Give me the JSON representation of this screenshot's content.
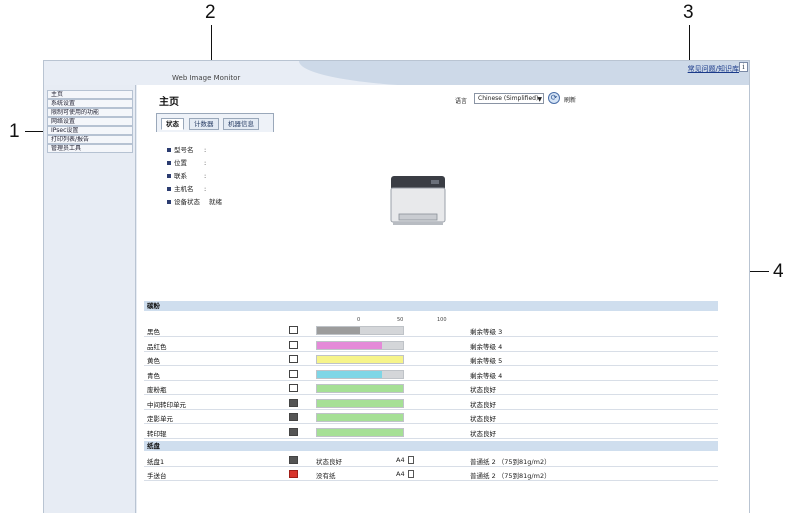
{
  "callouts": [
    "1",
    "2",
    "3",
    "4"
  ],
  "header": {
    "product_name": "Web Image Monitor",
    "help_link": "常见问题/知识库",
    "help_icon": "i"
  },
  "sidebar": {
    "items": [
      {
        "label": "主页"
      },
      {
        "label": "系统设置"
      },
      {
        "label": "限制可使用的功能"
      },
      {
        "label": "网络设置"
      },
      {
        "label": "IPsec设置"
      },
      {
        "label": "打印列表/报告"
      },
      {
        "label": "管理员工具"
      }
    ]
  },
  "main": {
    "title": "主页",
    "language_label": "语言",
    "language_value": "Chinese (Simplified)",
    "refresh_label": "刷新",
    "tabs": [
      {
        "label": "状态",
        "active": true
      },
      {
        "label": "计数器",
        "active": false
      },
      {
        "label": "机器信息",
        "active": false
      }
    ],
    "info": [
      {
        "label": "型号名",
        "value": ""
      },
      {
        "label": "位置",
        "value": ""
      },
      {
        "label": "联系",
        "value": ""
      },
      {
        "label": "主机名",
        "value": ""
      },
      {
        "label": "设备状态",
        "value": "就绪"
      }
    ]
  },
  "toner": {
    "heading": "碳粉",
    "scale": {
      "min": "0",
      "mid": "50",
      "max": "100"
    },
    "rows": [
      {
        "label": "黑色",
        "level_percent": 50,
        "color": "#9c9c9c",
        "status": "剩余等级 3"
      },
      {
        "label": "品红色",
        "level_percent": 75,
        "color": "#e48ad8",
        "status": "剩余等级 4"
      },
      {
        "label": "黄色",
        "level_percent": 100,
        "color": "#f6f48a",
        "status": "剩余等级 5"
      },
      {
        "label": "青色",
        "level_percent": 75,
        "color": "#7fd6e6",
        "status": "剩余等级 4"
      },
      {
        "label": "废粉瓶",
        "level_percent": 100,
        "color": "#a6e096",
        "status": "状态良好"
      },
      {
        "label": "中间转印单元",
        "level_percent": 100,
        "color": "#a6e096",
        "status": "状态良好"
      },
      {
        "label": "定影单元",
        "level_percent": 100,
        "color": "#a6e096",
        "status": "状态良好"
      },
      {
        "label": "转印辊",
        "level_percent": 100,
        "color": "#a6e096",
        "status": "状态良好"
      }
    ]
  },
  "tray": {
    "heading": "纸盘",
    "rows": [
      {
        "label": "纸盘1",
        "status": "状态良好",
        "size": "A4",
        "type": "普通纸 2 （75到81g/m2）",
        "icon": "tray-icon"
      },
      {
        "label": "手送台",
        "status": "没有纸",
        "size": "A4",
        "type": "普通纸 2 （75到81g/m2）",
        "icon": "bypass-tray-error-icon"
      }
    ]
  }
}
